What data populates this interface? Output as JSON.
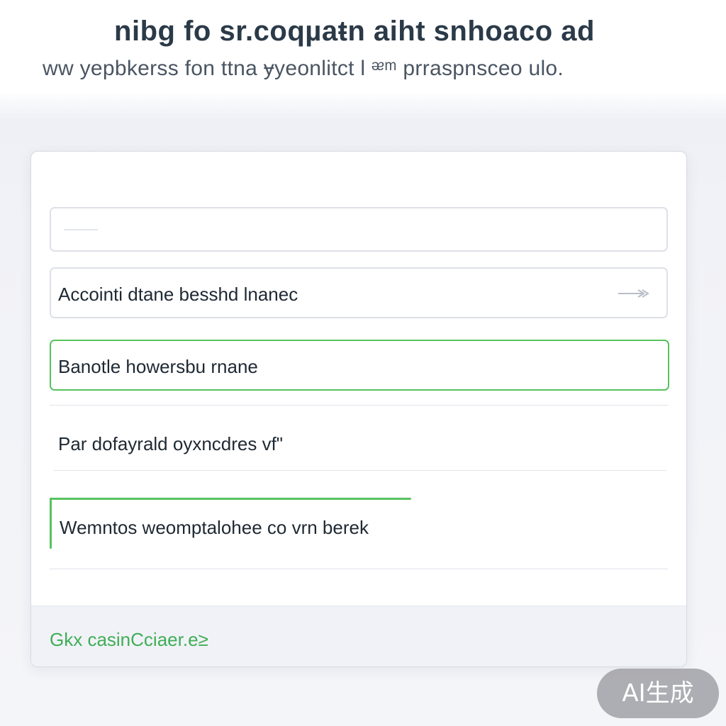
{
  "header": {
    "title": "nibg fo sr.coqµaŧn aiht snhoaco ad",
    "subtitle": "ww yepbkerss fon ttna ɏyeonlitct l ᵆᵐ prraspnsceo ulo."
  },
  "form": {
    "fields": [
      {
        "value": "",
        "placeholder": ""
      },
      {
        "value": "Accointi dtane besshd lnanec",
        "icon": "arrow-right-icon"
      },
      {
        "value": "Banotle howersbu rnane",
        "state": "focused",
        "accent_color": "#58c25f"
      }
    ],
    "rows": [
      {
        "label": "Par dofayrald oyxncdres vf\""
      },
      {
        "label": "Wemntos weomptalohee co vrn berek",
        "state": "active",
        "accent_color": "#58c25f"
      }
    ]
  },
  "footer": {
    "link_label": "Gkx casinCciaer.e≥",
    "link_color": "#3fae55"
  },
  "watermark": {
    "label": "AI生成"
  }
}
